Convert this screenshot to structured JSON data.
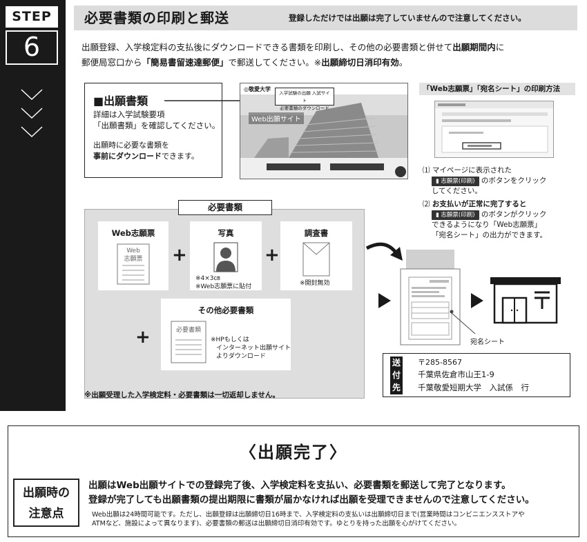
{
  "step": {
    "label": "STEP",
    "number": "6"
  },
  "header": {
    "title": "必要書類の印刷と郵送",
    "note": "登録しただけでは出願は完了していませんので注意してください。"
  },
  "intro": {
    "line1_a": "出願登録、入学検定料の支払後にダウンロードできる書類を印刷し、その他の必要書類と併せて",
    "line1_b": "出願期間内",
    "line1_c": "に",
    "line2_a": "郵便局窓口から",
    "line2_b": "「簡易書留速達郵便」",
    "line2_c": "で郵送してください。※",
    "line2_d": "出願締切日消印有効",
    "line2_e": "。"
  },
  "docs": {
    "heading": "■出願書類",
    "line1": "詳細は入学試験要項",
    "line2": "「出願書類」を確認してください。",
    "line3": "出願時に必要な書類を",
    "line4_bold": "事前にダウンロード",
    "line4_rest": "できます。"
  },
  "website": {
    "logo": "◎敬愛大学",
    "callout_l1": "入学試験の出願 入試サイト",
    "callout_l2": "必要書類のダウンロード",
    "site_name": "Web出願サイト"
  },
  "print_method": {
    "title": "「Web志願票」「宛名シート」の印刷方法",
    "step1_num": "⑴",
    "step1_l1": "マイページに表示された",
    "step1_chip": "志願票(印刷)",
    "step1_l2_rest": "のボタンをクリック",
    "step1_l3": "してください。",
    "step2_num": "⑵",
    "step2_l1": "お支払いが正常に完了すると",
    "step2_chip": "志願票(印刷)",
    "step2_l2_rest": "のボタンがクリック",
    "step2_l3": "できるようになり「Web志願票」",
    "step2_l4": "「宛名シート」の出力ができます。"
  },
  "required": {
    "title": "必要書類",
    "web_form": {
      "title": "Web志願票",
      "icon_text_1": "Web",
      "icon_text_2": "志願票"
    },
    "photo": {
      "title": "写真",
      "note1": "※4×3㎝",
      "note2": "※Web志願票に貼付"
    },
    "survey": {
      "title": "調査書",
      "note": "※開封無効"
    },
    "other": {
      "title": "その他必要書類",
      "icon_text": "必要書類",
      "note1": "※HPもしくは",
      "note2": "インターネット出願サイト",
      "note3": "よりダウンロード"
    },
    "plus": "+",
    "footnote": "※出願受理した入学検定料・必要書類は一切返却しません。"
  },
  "envelope": {
    "label": "宛名シート"
  },
  "send_to": {
    "tag": [
      "送",
      "付",
      "先"
    ],
    "postal": "〒285-8567",
    "address": "千葉県佐倉市山王1-9",
    "recipient": "千葉敬愛短期大学　入試係　行"
  },
  "completion": {
    "title": "〈出願完了〉",
    "caution_l1": "出願時の",
    "caution_l2": "注意点",
    "line1": "出願はWeb出願サイトでの登録完了後、入学検定料を支払い、必要書類を郵送して完了となります。",
    "line2": "登録が完了しても出願書類の提出期限に書類が届かなければ出願を受理できませんので注意してください。",
    "line3": "Web出願は24時間可能です。ただし、出願登録は出願締切日16時まで、入学検定料の支払いは出願締切日まで(営業時間はコンビニエンスストアや",
    "line4": "ATMなど、施設によって異なります)、必要書類の郵送は出願締切日消印有効です。ゆとりを持った出願を心がけてください。"
  }
}
